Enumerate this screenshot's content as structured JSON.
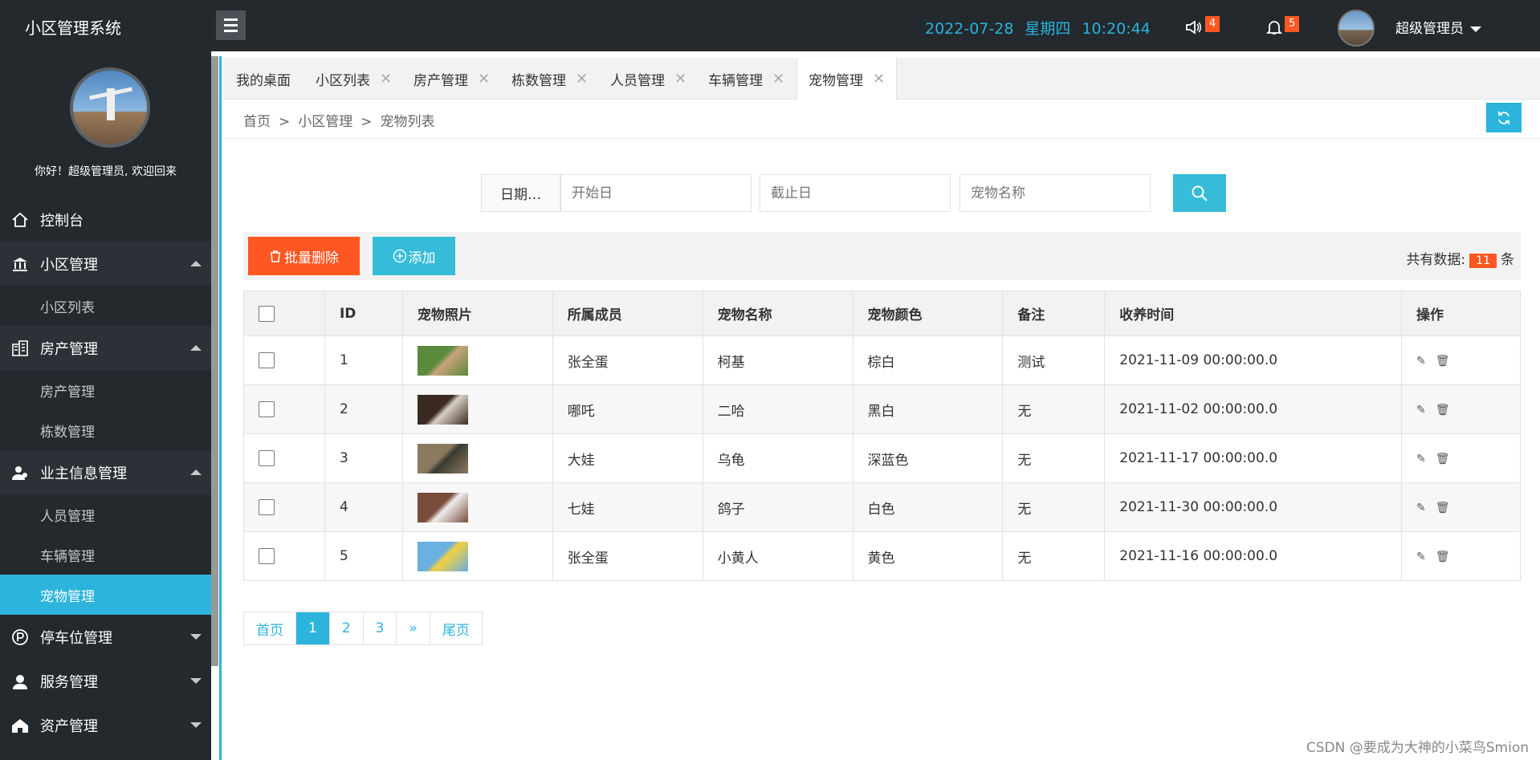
{
  "app": {
    "title": "小区管理系统"
  },
  "header": {
    "date": "2022-07-28",
    "weekday": "星期四",
    "time": "10:20:44",
    "speaker_badge": "4",
    "bell_badge": "5",
    "username": "超级管理员"
  },
  "sidebar": {
    "welcome": "你好！超级管理员, 欢迎回来",
    "items": [
      {
        "label": "控制台",
        "icon": "home-icon",
        "kind": "top"
      },
      {
        "label": "小区管理",
        "icon": "bank-icon",
        "kind": "group"
      },
      {
        "label": "小区列表",
        "kind": "sub"
      },
      {
        "label": "房产管理",
        "icon": "building-icon",
        "kind": "group"
      },
      {
        "label": "房产管理",
        "kind": "sub"
      },
      {
        "label": "栋数管理",
        "kind": "sub"
      },
      {
        "label": "业主信息管理",
        "icon": "users-icon",
        "kind": "group"
      },
      {
        "label": "人员管理",
        "kind": "sub"
      },
      {
        "label": "车辆管理",
        "kind": "sub"
      },
      {
        "label": "宠物管理",
        "kind": "sub-active"
      },
      {
        "label": "停车位管理",
        "icon": "parking-icon",
        "kind": "collapsed"
      },
      {
        "label": "服务管理",
        "icon": "service-icon",
        "kind": "collapsed"
      },
      {
        "label": "资产管理",
        "icon": "asset-icon",
        "kind": "collapsed"
      }
    ]
  },
  "tabs": [
    {
      "label": "我的桌面",
      "closable": false
    },
    {
      "label": "小区列表",
      "closable": true
    },
    {
      "label": "房产管理",
      "closable": true
    },
    {
      "label": "栋数管理",
      "closable": true
    },
    {
      "label": "人员管理",
      "closable": true
    },
    {
      "label": "车辆管理",
      "closable": true
    },
    {
      "label": "宠物管理",
      "closable": true,
      "active": true
    }
  ],
  "breadcrumb": [
    "首页",
    "小区管理",
    "宠物列表"
  ],
  "search": {
    "date_label": "日期…",
    "start_placeholder": "开始日",
    "end_placeholder": "截止日",
    "name_placeholder": "宠物名称"
  },
  "toolbar": {
    "batch_delete": "批量删除",
    "add": "添加",
    "total_label": "共有数据:",
    "total_count": "11",
    "total_unit": "条"
  },
  "table": {
    "headers": [
      "",
      "ID",
      "宠物照片",
      "所属成员",
      "宠物名称",
      "宠物颜色",
      "备注",
      "收养时间",
      "操作"
    ],
    "rows": [
      {
        "id": "1",
        "owner": "张全蛋",
        "name": "柯基",
        "color": "棕白",
        "note": "测试",
        "time": "2021-11-09 00:00:00.0",
        "photo": [
          "#5a8a3c",
          "#c9a27a"
        ]
      },
      {
        "id": "2",
        "owner": "哪吒",
        "name": "二哈",
        "color": "黑白",
        "note": "无",
        "time": "2021-11-02 00:00:00.0",
        "photo": [
          "#3a2a22",
          "#d8d0c8"
        ]
      },
      {
        "id": "3",
        "owner": "大娃",
        "name": "乌龟",
        "color": "深蓝色",
        "note": "无",
        "time": "2021-11-17 00:00:00.0",
        "photo": [
          "#8a7a60",
          "#3b3a30"
        ]
      },
      {
        "id": "4",
        "owner": "七娃",
        "name": "鸽子",
        "color": "白色",
        "note": "无",
        "time": "2021-11-30 00:00:00.0",
        "photo": [
          "#7a4a3a",
          "#eeeeee"
        ]
      },
      {
        "id": "5",
        "owner": "张全蛋",
        "name": "小黄人",
        "color": "黄色",
        "note": "无",
        "time": "2021-11-16 00:00:00.0",
        "photo": [
          "#6ab0e0",
          "#f2d040"
        ]
      }
    ]
  },
  "pager": [
    "首页",
    "1",
    "2",
    "3",
    "»",
    "尾页"
  ],
  "watermark": "CSDN @要成为大神的小菜鸟Smion",
  "colors": {
    "accent": "#2cb4dc",
    "danger": "#ff5722",
    "dark": "#23292d"
  }
}
